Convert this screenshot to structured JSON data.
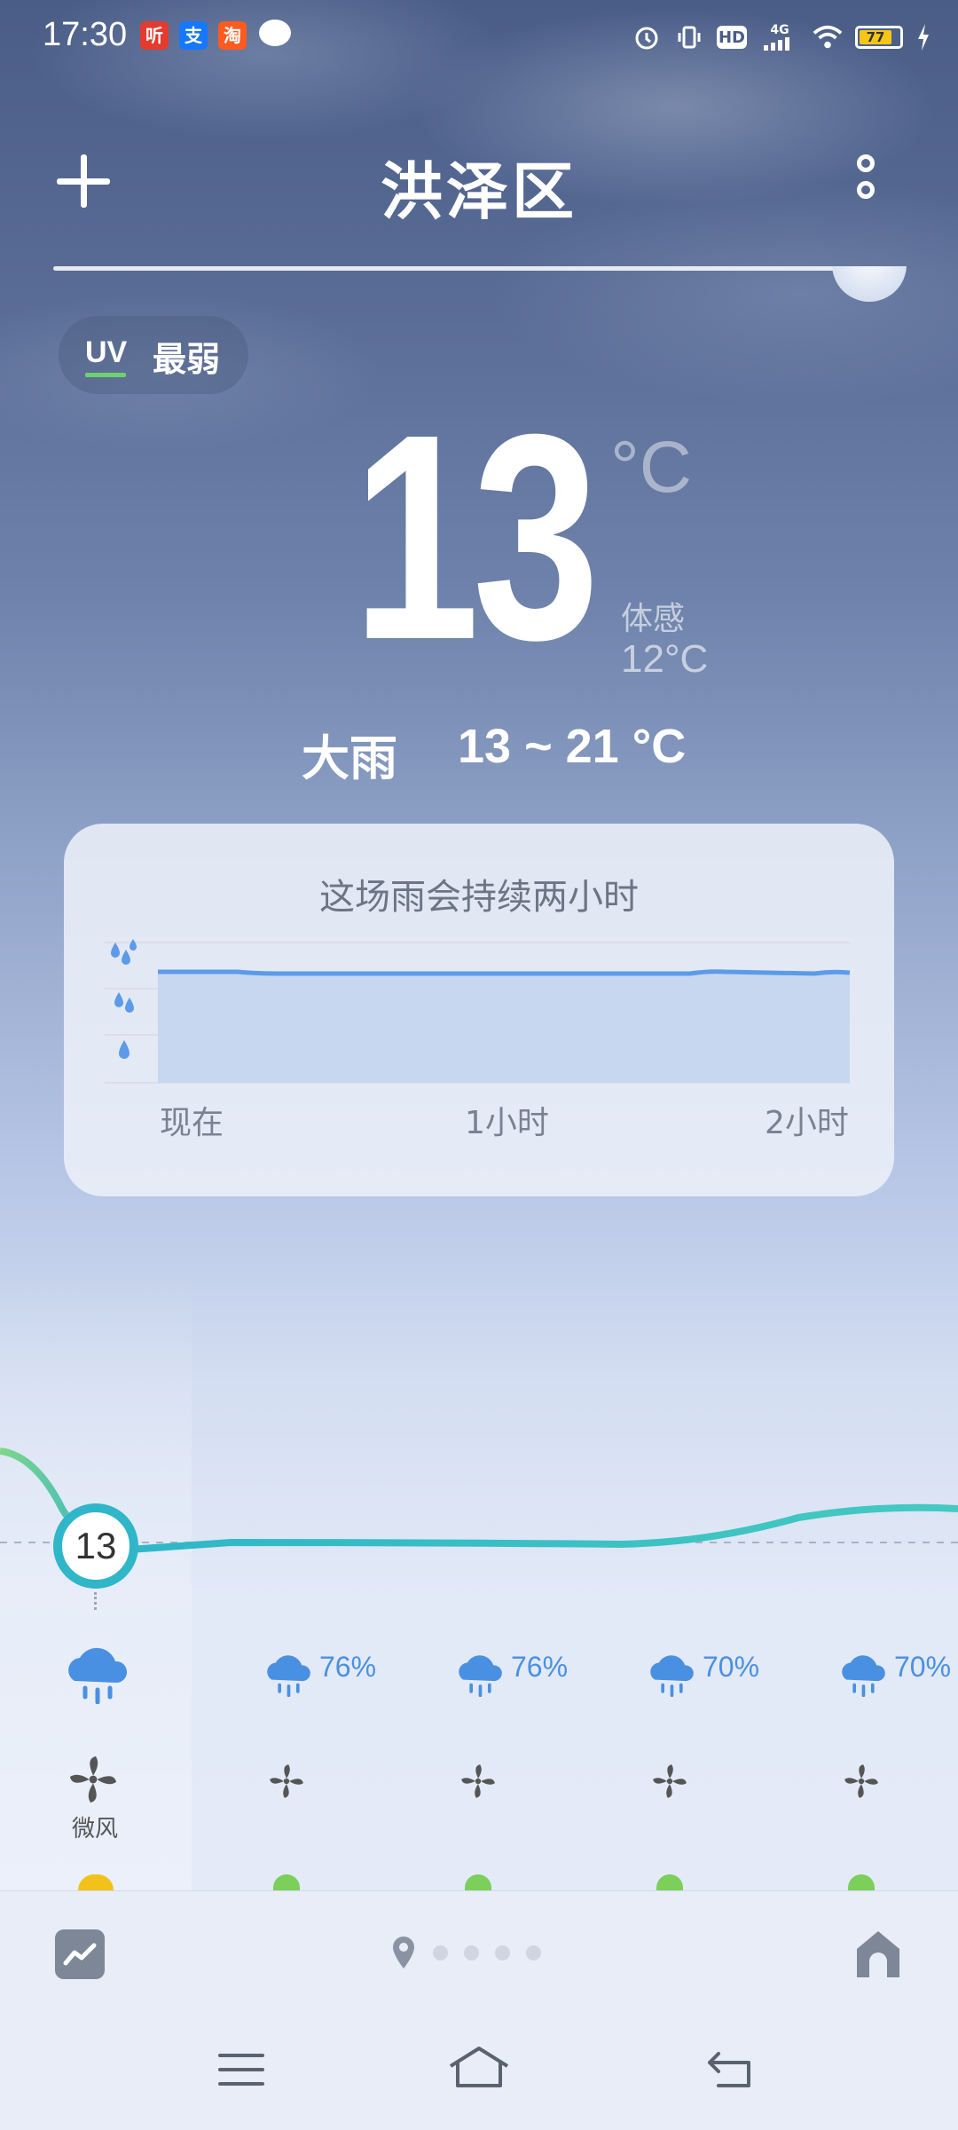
{
  "status_bar": {
    "time": "17:30",
    "apps": [
      "听",
      "支",
      "淘"
    ],
    "hd": "HD",
    "network": "4G",
    "battery": "77"
  },
  "header": {
    "city": "洪泽区"
  },
  "current": {
    "uv_label": "UV",
    "uv_value": "最弱",
    "temp": "13",
    "unit": "°C",
    "feels_label": "体感",
    "feels_value": "12°C",
    "condition": "大雨",
    "range": "13 ~ 21 °C"
  },
  "rain_card": {
    "title": "这场雨会持续两小时",
    "x_labels": [
      "现在",
      "1小时",
      "2小时"
    ]
  },
  "hourly": {
    "now_temp": "13",
    "precip": [
      "76%",
      "76%",
      "70%",
      "70%"
    ],
    "wind_label": "微风"
  },
  "colors": {
    "accent_rain": "#4a90e2",
    "temp_curve": "#2fb6c8",
    "uv_indicator": "#6fd26f"
  }
}
